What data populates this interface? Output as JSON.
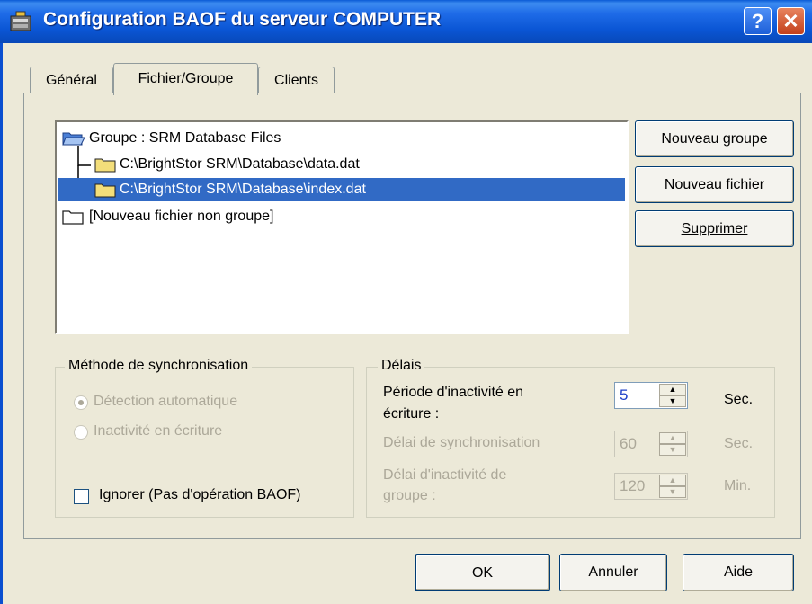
{
  "window": {
    "title": "Configuration BAOF du serveur COMPUTER",
    "help_label": "?",
    "close_label": "✕"
  },
  "tabs": [
    {
      "label": "Général",
      "active": false
    },
    {
      "label": "Fichier/Groupe",
      "active": true
    },
    {
      "label": "Clients",
      "active": false
    }
  ],
  "tree": {
    "items": [
      {
        "label": "Groupe : SRM Database Files",
        "icon": "open-folder-icon",
        "selected": false
      },
      {
        "label": "C:\\BrightStor SRM\\Database\\data.dat",
        "icon": "folder-icon",
        "selected": false
      },
      {
        "label": "C:\\BrightStor SRM\\Database\\index.dat",
        "icon": "folder-icon",
        "selected": true
      },
      {
        "label": "[Nouveau fichier non groupe]",
        "icon": "empty-folder-icon",
        "selected": false
      }
    ]
  },
  "side_buttons": {
    "new_group": "Nouveau groupe",
    "new_file": "Nouveau fichier",
    "delete": "Supprimer"
  },
  "sync_method": {
    "title": "Méthode de synchronisation",
    "options": [
      {
        "label": "Détection automatique",
        "checked": true,
        "enabled": false
      },
      {
        "label": "Inactivité en écriture",
        "checked": false,
        "enabled": false
      }
    ],
    "ignore_label": "Ignorer (Pas d'opération BAOF)",
    "ignore_checked": false
  },
  "delays": {
    "title": "Délais",
    "write_inactivity": {
      "label_line1": "Période d'inactivité en",
      "label_line2": "écriture :",
      "value": "5",
      "unit": "Sec."
    },
    "sync_delay": {
      "label": "Délai de synchronisation",
      "value": "60",
      "unit": "Sec."
    },
    "group_inactivity": {
      "label_line1": "Délai d'inactivité de",
      "label_line2": "groupe :",
      "value": "120",
      "unit": "Min."
    }
  },
  "bottom_buttons": {
    "ok": "OK",
    "cancel": "Annuler",
    "help": "Aide"
  },
  "colors": {
    "titlebar": "#0a55d4",
    "selection": "#316ac5",
    "dialog_bg": "#ece9d8"
  }
}
